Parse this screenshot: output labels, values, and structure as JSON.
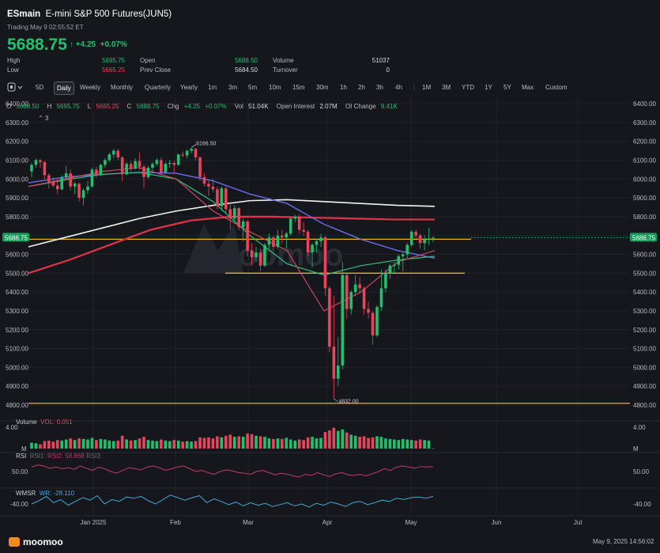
{
  "header": {
    "symbol": "ESmain",
    "name": "E-mini S&P 500 Futures(JUN5)",
    "trading_time": "Trading May 9 02:55:52 ET",
    "price": "5688.75",
    "change": "+4.25",
    "change_pct": "+0.07%",
    "stats": {
      "high_label": "High",
      "high": "5695.75",
      "low_label": "Low",
      "low": "5665.25",
      "open_label": "Open",
      "open": "5688.50",
      "prev_close_label": "Prev Close",
      "prev_close": "5684.50",
      "volume_label": "Volume",
      "volume": "51037",
      "turnover_label": "Turnover",
      "turnover": "0"
    }
  },
  "toolbar": {
    "chart_icon": "candlestick-icon",
    "items": [
      "5D",
      "Daily",
      "Weekly",
      "Monthly",
      "Quarterly",
      "Yearly",
      "1m",
      "3m",
      "5m",
      "10m",
      "15m",
      "30m",
      "1h",
      "2h",
      "3h",
      "4h",
      "1M",
      "3M",
      "YTD",
      "1Y",
      "5Y",
      "Max",
      "Custom"
    ],
    "active": "Daily"
  },
  "ohlc": {
    "o_label": "O",
    "o": "5688.50",
    "h_label": "H",
    "h": "5695.75",
    "l_label": "L",
    "l": "5665.25",
    "c_label": "C",
    "c": "5688.75",
    "chg_label": "Chg",
    "chg": "+4.25",
    "chg_pct": "+0.07%",
    "vol_label": "Vol",
    "vol": "51.04K",
    "oi_label": "Open Interest",
    "oi": "2.07M",
    "oic_label": "OI Change",
    "oic": "9.41K",
    "collapse": "3"
  },
  "price_axis": {
    "labels": [
      "6400.00",
      "6300.00",
      "6200.00",
      "6100.00",
      "6000.00",
      "5900.00",
      "5800.00",
      "5700.00",
      "5600.00",
      "5500.00",
      "5400.00",
      "5300.00",
      "5200.00",
      "5100.00",
      "5000.00",
      "4900.00",
      "4800.00"
    ],
    "current": "5688.75",
    "high_mark": "6166.50",
    "low_mark": "4832.00"
  },
  "volume_panel": {
    "label": "Volume",
    "vol_text": "VOL: 0.051",
    "top_label": "4.00",
    "bottom_label": "M"
  },
  "rsi_panel": {
    "label": "RSI",
    "rsi1": "RSI1:",
    "rsi2": "RSI2: 58.868",
    "rsi3": "RSI3:",
    "level": "50.00"
  },
  "wmsr_panel": {
    "label": "WMSR",
    "wr": "WR: -28.110",
    "level": "-40.00"
  },
  "time_axis": [
    "Jan 2025",
    "Feb",
    "Mar",
    "Apr",
    "May",
    "Jun",
    "Jul"
  ],
  "watermark": "moomoo",
  "footer": {
    "logo": "moomoo",
    "timestamp": "May 9, 2025 14:56:02"
  },
  "colors": {
    "up": "#21c06e",
    "down": "#e8455c",
    "hline": "#e7b416",
    "ma_white": "#f2f2f2",
    "ma_red": "#e0344b",
    "ma_blue": "#6b6fe8",
    "ma_green": "#2fbf7c",
    "ma_pink": "#c9485e",
    "rsi": "#c2386a",
    "wr": "#3fa9d9"
  },
  "chart_data": {
    "type": "candlestick",
    "x": [
      "2024-12-23",
      "2024-12-24",
      "2024-12-26",
      "2024-12-27",
      "2024-12-30",
      "2024-12-31",
      "2025-01-02",
      "2025-01-03",
      "2025-01-06",
      "2025-01-07",
      "2025-01-08",
      "2025-01-10",
      "2025-01-13",
      "2025-01-14",
      "2025-01-15",
      "2025-01-16",
      "2025-01-17",
      "2025-01-21",
      "2025-01-22",
      "2025-01-23",
      "2025-01-24",
      "2025-01-27",
      "2025-01-28",
      "2025-01-29",
      "2025-01-30",
      "2025-01-31",
      "2025-02-03",
      "2025-02-04",
      "2025-02-05",
      "2025-02-06",
      "2025-02-07",
      "2025-02-10",
      "2025-02-11",
      "2025-02-12",
      "2025-02-13",
      "2025-02-14",
      "2025-02-18",
      "2025-02-19",
      "2025-02-20",
      "2025-02-21",
      "2025-02-24",
      "2025-02-25",
      "2025-02-26",
      "2025-02-27",
      "2025-02-28",
      "2025-03-03",
      "2025-03-04",
      "2025-03-05",
      "2025-03-06",
      "2025-03-07",
      "2025-03-10",
      "2025-03-11",
      "2025-03-12",
      "2025-03-13",
      "2025-03-14",
      "2025-03-17",
      "2025-03-18",
      "2025-03-19",
      "2025-03-20",
      "2025-03-21",
      "2025-03-24",
      "2025-03-25",
      "2025-03-26",
      "2025-03-27",
      "2025-03-28",
      "2025-03-31",
      "2025-04-01",
      "2025-04-02",
      "2025-04-03",
      "2025-04-04",
      "2025-04-07",
      "2025-04-08",
      "2025-04-09",
      "2025-04-10",
      "2025-04-11",
      "2025-04-14",
      "2025-04-15",
      "2025-04-16",
      "2025-04-17",
      "2025-04-21",
      "2025-04-22",
      "2025-04-23",
      "2025-04-24",
      "2025-04-25",
      "2025-04-28",
      "2025-04-29",
      "2025-04-30",
      "2025-05-01",
      "2025-05-02",
      "2025-05-05",
      "2025-05-06",
      "2025-05-07",
      "2025-05-08",
      "2025-05-09"
    ],
    "ohlc": [
      [
        6040,
        6085,
        6010,
        6075
      ],
      [
        6075,
        6110,
        6060,
        6100
      ],
      [
        6100,
        6105,
        6060,
        6090
      ],
      [
        6090,
        6095,
        6000,
        6020
      ],
      [
        6020,
        6030,
        5950,
        5985
      ],
      [
        5985,
        6010,
        5955,
        5965
      ],
      [
        5965,
        6000,
        5920,
        5945
      ],
      [
        5945,
        6020,
        5940,
        6010
      ],
      [
        6010,
        6070,
        6000,
        6030
      ],
      [
        6030,
        6050,
        5940,
        5960
      ],
      [
        5960,
        5985,
        5920,
        5975
      ],
      [
        5975,
        5980,
        5880,
        5900
      ],
      [
        5900,
        5950,
        5860,
        5940
      ],
      [
        5940,
        5990,
        5920,
        5960
      ],
      [
        5960,
        6060,
        5955,
        6050
      ],
      [
        6050,
        6065,
        6010,
        6020
      ],
      [
        6020,
        6080,
        6015,
        6075
      ],
      [
        6075,
        6110,
        6060,
        6100
      ],
      [
        6100,
        6140,
        6090,
        6130
      ],
      [
        6130,
        6160,
        6110,
        6150
      ],
      [
        6150,
        6160,
        6100,
        6115
      ],
      [
        6115,
        6120,
        5990,
        6025
      ],
      [
        6025,
        6090,
        6020,
        6080
      ],
      [
        6080,
        6095,
        6040,
        6055
      ],
      [
        6055,
        6110,
        6050,
        6095
      ],
      [
        6095,
        6140,
        6050,
        6065
      ],
      [
        6065,
        6075,
        5950,
        6010
      ],
      [
        6010,
        6070,
        6000,
        6060
      ],
      [
        6060,
        6090,
        6040,
        6080
      ],
      [
        6080,
        6110,
        6070,
        6100
      ],
      [
        6100,
        6115,
        6020,
        6035
      ],
      [
        6035,
        6090,
        6030,
        6080
      ],
      [
        6080,
        6100,
        6060,
        6085
      ],
      [
        6085,
        6095,
        6030,
        6075
      ],
      [
        6075,
        6135,
        6070,
        6130
      ],
      [
        6130,
        6145,
        6115,
        6125
      ],
      [
        6125,
        6155,
        6110,
        6150
      ],
      [
        6150,
        6166.5,
        6135,
        6160
      ],
      [
        6160,
        6165,
        6100,
        6115
      ],
      [
        6115,
        6120,
        5990,
        6010
      ],
      [
        6010,
        6030,
        5960,
        5975
      ],
      [
        5975,
        5990,
        5910,
        5960
      ],
      [
        5960,
        6000,
        5930,
        5945
      ],
      [
        5945,
        5960,
        5840,
        5855
      ],
      [
        5855,
        5960,
        5830,
        5950
      ],
      [
        5950,
        5960,
        5820,
        5840
      ],
      [
        5840,
        5880,
        5730,
        5790
      ],
      [
        5790,
        5860,
        5770,
        5845
      ],
      [
        5845,
        5850,
        5730,
        5745
      ],
      [
        5745,
        5790,
        5670,
        5775
      ],
      [
        5775,
        5780,
        5590,
        5620
      ],
      [
        5620,
        5660,
        5540,
        5585
      ],
      [
        5585,
        5640,
        5560,
        5610
      ],
      [
        5610,
        5630,
        5510,
        5540
      ],
      [
        5540,
        5660,
        5535,
        5650
      ],
      [
        5650,
        5710,
        5630,
        5690
      ],
      [
        5690,
        5700,
        5620,
        5640
      ],
      [
        5640,
        5730,
        5630,
        5700
      ],
      [
        5700,
        5730,
        5660,
        5690
      ],
      [
        5690,
        5720,
        5630,
        5710
      ],
      [
        5710,
        5800,
        5700,
        5790
      ],
      [
        5790,
        5810,
        5770,
        5800
      ],
      [
        5800,
        5810,
        5710,
        5730
      ],
      [
        5730,
        5770,
        5700,
        5720
      ],
      [
        5720,
        5730,
        5590,
        5610
      ],
      [
        5610,
        5660,
        5530,
        5650
      ],
      [
        5650,
        5680,
        5610,
        5670
      ],
      [
        5670,
        5710,
        5640,
        5690
      ],
      [
        5690,
        5700,
        5380,
        5420
      ],
      [
        5420,
        5430,
        5080,
        5110
      ],
      [
        5110,
        5380,
        4832,
        4940
      ],
      [
        4940,
        5160,
        4900,
        5010
      ],
      [
        5010,
        5560,
        4990,
        5490
      ],
      [
        5490,
        5500,
        5260,
        5310
      ],
      [
        5310,
        5410,
        5280,
        5400
      ],
      [
        5400,
        5490,
        5380,
        5440
      ],
      [
        5440,
        5480,
        5390,
        5420
      ],
      [
        5420,
        5430,
        5280,
        5310
      ],
      [
        5310,
        5350,
        5260,
        5290
      ],
      [
        5290,
        5300,
        5120,
        5170
      ],
      [
        5170,
        5330,
        5160,
        5320
      ],
      [
        5320,
        5520,
        5300,
        5420
      ],
      [
        5420,
        5520,
        5400,
        5500
      ],
      [
        5500,
        5550,
        5470,
        5540
      ],
      [
        5540,
        5560,
        5500,
        5545
      ],
      [
        5545,
        5600,
        5520,
        5590
      ],
      [
        5590,
        5610,
        5510,
        5600
      ],
      [
        5600,
        5660,
        5580,
        5650
      ],
      [
        5650,
        5730,
        5640,
        5720
      ],
      [
        5720,
        5730,
        5680,
        5700
      ],
      [
        5700,
        5710,
        5630,
        5660
      ],
      [
        5660,
        5700,
        5620,
        5680
      ],
      [
        5680,
        5740,
        5650,
        5684.5
      ],
      [
        5688.5,
        5695.75,
        5665.25,
        5688.75
      ]
    ],
    "volume_m": [
      1.1,
      1.0,
      0.8,
      1.4,
      1.5,
      1.3,
      1.6,
      1.5,
      1.7,
      1.9,
      1.6,
      1.9,
      1.8,
      1.7,
      2.0,
      1.6,
      1.8,
      1.7,
      1.5,
      1.4,
      1.5,
      2.4,
      1.7,
      1.5,
      1.6,
      1.9,
      2.2,
      1.6,
      1.5,
      1.4,
      1.7,
      1.5,
      1.4,
      1.6,
      1.5,
      1.3,
      1.4,
      1.3,
      1.4,
      2.1,
      2.0,
      2.1,
      1.9,
      2.3,
      2.1,
      2.4,
      2.6,
      2.2,
      2.3,
      2.2,
      2.8,
      2.7,
      2.4,
      2.3,
      2.2,
      1.9,
      1.8,
      1.9,
      1.8,
      2.0,
      1.7,
      1.5,
      1.7,
      1.6,
      2.1,
      2.2,
      1.9,
      2.0,
      3.1,
      3.4,
      3.9,
      3.3,
      3.6,
      3.0,
      2.6,
      2.4,
      2.2,
      2.3,
      2.0,
      2.1,
      2.3,
      2.2,
      1.9,
      1.8,
      1.7,
      1.6,
      1.8,
      1.7,
      1.6,
      1.5,
      1.7,
      1.6,
      1.5,
      0.05
    ],
    "ylim": [
      4750,
      6420
    ],
    "horizontal_lines": [
      5688.75,
      5500,
      4780
    ],
    "moving_averages": {
      "ma_white": [
        5640,
        5690,
        5740,
        5790,
        5830,
        5860,
        5885,
        5890,
        5880,
        5870,
        5860,
        5855
      ],
      "ma_red": [
        5500,
        5570,
        5650,
        5730,
        5780,
        5800,
        5800,
        5795,
        5790,
        5785,
        5785
      ],
      "ma_blue": [
        5980,
        6010,
        6025,
        6035,
        6030,
        5990,
        5920,
        5870,
        5760,
        5680,
        5620,
        5580
      ],
      "ma_green": [
        5960,
        5995,
        6025,
        6035,
        6000,
        5880,
        5700,
        5550,
        5490,
        5540,
        5570,
        5590
      ],
      "ma_pink": [
        5960,
        6000,
        6040,
        6060,
        6000,
        5830,
        5720,
        5620,
        5300,
        5400,
        5560,
        5620
      ]
    },
    "rsi2": 58.868,
    "wr": -28.11
  }
}
